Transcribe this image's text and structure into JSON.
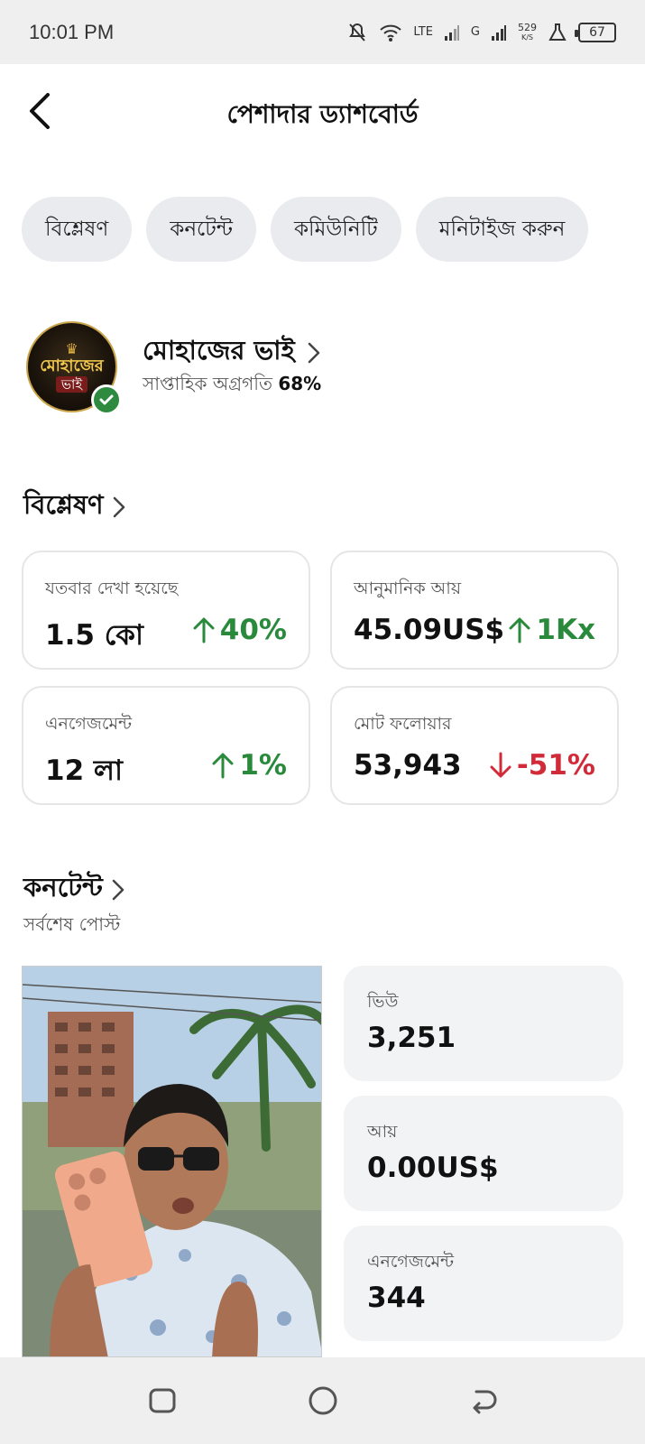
{
  "status_bar": {
    "time": "10:01 PM",
    "network_lte": "LTE",
    "network_g": "G",
    "speed_value": "529",
    "speed_unit": "K/S",
    "battery": "67"
  },
  "header": {
    "title": "পেশাদার ড্যাশবোর্ড"
  },
  "tabs": [
    {
      "label": "বিশ্লেষণ"
    },
    {
      "label": "কনটেন্ট"
    },
    {
      "label": "কমিউনিটি"
    },
    {
      "label": "মনিটাইজ করুন"
    }
  ],
  "profile": {
    "name": "মোহাজের ভাই",
    "avatar_text_line1": "মোহাজের",
    "avatar_text_line2": "ভাই",
    "progress_label": "সাপ্তাহিক অগ্রগতি",
    "progress_value": "68%"
  },
  "analytics": {
    "title": "বিশ্লেষণ",
    "metrics": [
      {
        "label": "যতবার দেখা হয়েছে",
        "value": "1.5 কো",
        "change": "40%",
        "direction": "up"
      },
      {
        "label": "আনুমানিক আয়",
        "value": "45.09US$",
        "change": "1Kx",
        "direction": "up"
      },
      {
        "label": "এনগেজমেন্ট",
        "value": "12 লা",
        "change": "1%",
        "direction": "up"
      },
      {
        "label": "মোট ফলোয়ার",
        "value": "53,943",
        "change": "-51%",
        "direction": "down"
      }
    ]
  },
  "content": {
    "title": "কনটেন্ট",
    "subtitle": "সর্বশেষ পোস্ট",
    "stats": [
      {
        "label": "ভিউ",
        "value": "3,251"
      },
      {
        "label": "আয়",
        "value": "0.00US$"
      },
      {
        "label": "এনগেজমেন্ট",
        "value": "344"
      }
    ]
  },
  "colors": {
    "up": "#2a8a3c",
    "down": "#d12b3a",
    "verified": "#2d8a3e",
    "chip_bg": "#e9ebee"
  }
}
